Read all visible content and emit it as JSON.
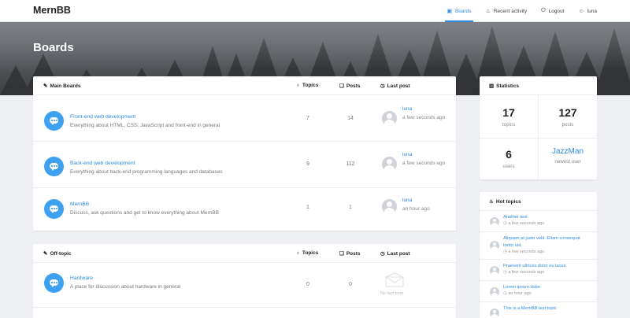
{
  "nav": {
    "brand": "MernBB",
    "items": [
      {
        "label": "Boards",
        "icon": "boards-icon"
      },
      {
        "label": "Recent activity",
        "icon": "flame-icon"
      },
      {
        "label": "Logout",
        "icon": "logout-icon"
      },
      {
        "label": "luna",
        "icon": "user-icon"
      }
    ]
  },
  "hero": {
    "title": "Boards"
  },
  "main_boards": {
    "title": "Main Boards",
    "columns": {
      "topics": "Topics",
      "posts": "Posts",
      "last_post": "Last post"
    },
    "rows": [
      {
        "name": "Front-end web development",
        "desc": "Everything about HTML, CSS, JavaScript and front-end in general",
        "topics": "7",
        "posts": "14",
        "user": "luna",
        "time": "a few seconds ago"
      },
      {
        "name": "Back-end web development",
        "desc": "Everything about back-end programming languages and databases",
        "topics": "9",
        "posts": "112",
        "user": "luna",
        "time": "a few seconds ago"
      },
      {
        "name": "MernBB",
        "desc": "Discuss, ask questions and get to know everything about MernBB",
        "topics": "1",
        "posts": "1",
        "user": "luna",
        "time": "an hour ago"
      }
    ]
  },
  "off_topic": {
    "title": "Off-topic",
    "columns": {
      "topics": "Topics",
      "posts": "Posts",
      "last_post": "Last post"
    },
    "rows": [
      {
        "name": "Hardware",
        "desc": "A place for discussion about hardware in general",
        "topics": "0",
        "posts": "0",
        "empty": "No last post"
      }
    ]
  },
  "statistics": {
    "title": "Statistics",
    "topics_value": "17",
    "topics_label": "topics",
    "posts_value": "127",
    "posts_label": "posts",
    "users_value": "6",
    "users_label": "users",
    "newest_value": "JazzMan",
    "newest_label": "newest user"
  },
  "hot_topics": {
    "title": "Hot topics",
    "items": [
      {
        "title": "Another test",
        "time": "a few seconds ago"
      },
      {
        "title": "Aliquam at justo velit. Etiam consequat tortor vel.",
        "time": "a few seconds ago"
      },
      {
        "title": "Praesent ultrices dolor eu lacus",
        "time": "a few seconds ago"
      },
      {
        "title": "Lorem ipsum dolor",
        "time": "an hour ago"
      },
      {
        "title": "This is a MernBB test topic",
        "time": ""
      }
    ]
  },
  "colors": {
    "accent": "#2d8ae0",
    "bubble": "#3ea0f0",
    "background": "#eef0f4"
  }
}
